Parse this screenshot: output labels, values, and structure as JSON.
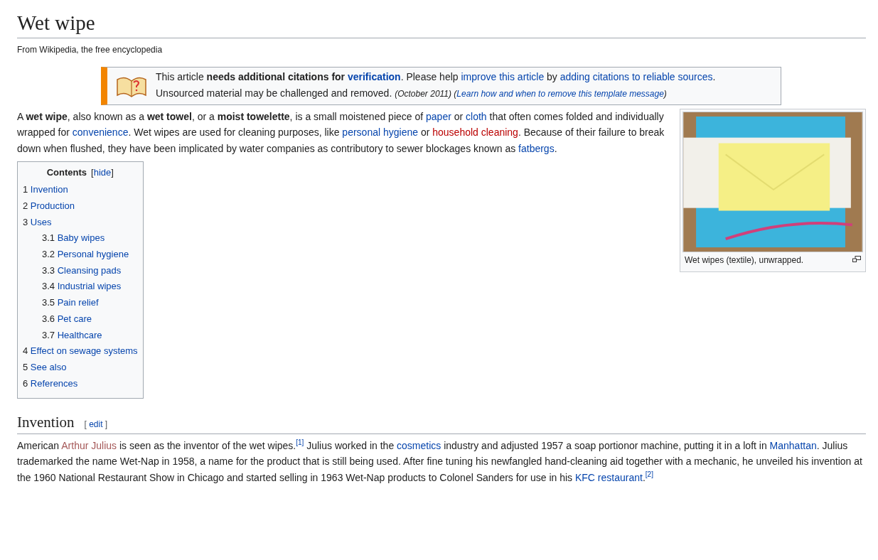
{
  "title": "Wet wipe",
  "tagline": "From Wikipedia, the free encyclopedia",
  "notice": {
    "line_1": [
      {
        "kind": "text",
        "text": "This article "
      },
      {
        "kind": "bold",
        "text": "needs additional citations for "
      },
      {
        "kind": "boldlink",
        "text": "verification"
      },
      {
        "kind": "text",
        "text": ". Please help "
      },
      {
        "kind": "link",
        "text": "improve this article"
      },
      {
        "kind": "text",
        "text": " by "
      },
      {
        "kind": "link",
        "text": "adding citations to reliable sources"
      },
      {
        "kind": "text",
        "text": "."
      }
    ],
    "line_2": [
      {
        "kind": "text",
        "text": "Unsourced material may be challenged and removed. "
      },
      {
        "kind": "italic",
        "text": "(October 2011)"
      },
      {
        "kind": "italic",
        "text": " ("
      },
      {
        "kind": "italiclink",
        "text": "Learn how and when to remove this template message"
      },
      {
        "kind": "italic",
        "text": ")"
      }
    ]
  },
  "intro": [
    {
      "kind": "text",
      "text": "A "
    },
    {
      "kind": "bold",
      "text": "wet wipe"
    },
    {
      "kind": "text",
      "text": ", also known as a "
    },
    {
      "kind": "bold",
      "text": "wet towel"
    },
    {
      "kind": "text",
      "text": ", or a "
    },
    {
      "kind": "bold",
      "text": "moist towelette"
    },
    {
      "kind": "text",
      "text": ", is a small moistened piece of "
    },
    {
      "kind": "link",
      "text": "paper"
    },
    {
      "kind": "text",
      "text": " or "
    },
    {
      "kind": "link",
      "text": "cloth"
    },
    {
      "kind": "text",
      "text": " that often comes folded and individually wrapped for "
    },
    {
      "kind": "link",
      "text": "convenience"
    },
    {
      "kind": "text",
      "text": ". Wet wipes are used for cleaning purposes, like "
    },
    {
      "kind": "link",
      "text": "personal hygiene"
    },
    {
      "kind": "text",
      "text": " or "
    },
    {
      "kind": "redlink",
      "text": "household cleaning"
    },
    {
      "kind": "text",
      "text": ". Because of their failure to break down when flushed, they have been implicated by water companies as contributory to sewer blockages known as "
    },
    {
      "kind": "link",
      "text": "fatbergs"
    },
    {
      "kind": "text",
      "text": "."
    }
  ],
  "figure": {
    "caption": "Wet wipes (textile), unwrapped."
  },
  "toc": {
    "title": "Contents",
    "toggle_open": "[",
    "toggle": "hide",
    "toggle_close": "]",
    "items": [
      {
        "number": "1",
        "label": "Invention"
      },
      {
        "number": "2",
        "label": "Production"
      },
      {
        "number": "3",
        "label": "Uses",
        "children": [
          {
            "number": "3.1",
            "label": "Baby wipes"
          },
          {
            "number": "3.2",
            "label": "Personal hygiene"
          },
          {
            "number": "3.3",
            "label": "Cleansing pads"
          },
          {
            "number": "3.4",
            "label": "Industrial wipes"
          },
          {
            "number": "3.5",
            "label": "Pain relief"
          },
          {
            "number": "3.6",
            "label": "Pet care"
          },
          {
            "number": "3.7",
            "label": "Healthcare"
          }
        ]
      },
      {
        "number": "4",
        "label": "Effect on sewage systems"
      },
      {
        "number": "5",
        "label": "See also"
      },
      {
        "number": "6",
        "label": "References"
      }
    ]
  },
  "sections": [
    {
      "heading": "Invention",
      "edit_open": "[",
      "edit": "edit",
      "edit_close": "]",
      "paragraph": [
        {
          "kind": "text",
          "text": "American "
        },
        {
          "kind": "visited",
          "text": "Arthur Julius"
        },
        {
          "kind": "text",
          "text": " is seen as the inventor of the wet wipes."
        },
        {
          "kind": "ref",
          "text": "[1]"
        },
        {
          "kind": "text",
          "text": " Julius worked in the "
        },
        {
          "kind": "link",
          "text": "cosmetics"
        },
        {
          "kind": "text",
          "text": " industry and adjusted 1957 a soap portionor machine, putting it in a loft in "
        },
        {
          "kind": "link",
          "text": "Manhattan"
        },
        {
          "kind": "text",
          "text": ". Julius trademarked the name Wet-Nap in 1958, a name for the product that is still being used. After fine tuning his newfangled hand-cleaning aid together with a mechanic, he unveiled his invention at the 1960 National Restaurant Show in Chicago and started selling in 1963 Wet-Nap products to Colonel Sanders for use in his "
        },
        {
          "kind": "link",
          "text": "KFC restaurant"
        },
        {
          "kind": "text",
          "text": "."
        },
        {
          "kind": "ref",
          "text": "[2]"
        }
      ]
    }
  ]
}
